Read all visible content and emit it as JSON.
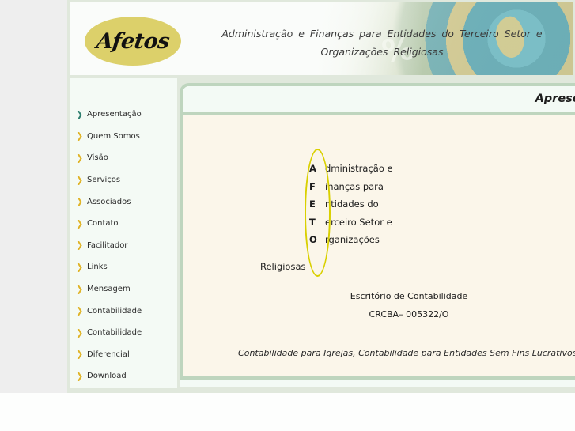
{
  "colors": {
    "page_border": "#bed5be",
    "logo_bg": "#dcd06a",
    "arrow_default": "#e0b429",
    "arrow_active": "#2f7f6f",
    "oval": "#d9d000",
    "content_bg": "#fbf6ea",
    "sidebar_bg": "#f4faf5",
    "gutter": "#eeeeee"
  },
  "header": {
    "logo_text": "Afetos",
    "tagline_line1": "Administração e Finanças para Entidades do Terceiro Setor e",
    "tagline_line2": "Organizações Religiosas",
    "photo_icon": "globe-icon",
    "percent_glyph": "%"
  },
  "sidebar": {
    "items": [
      {
        "label": "Apresentação",
        "active": true,
        "icon": "chevron-right-icon"
      },
      {
        "label": "Quem Somos",
        "active": false,
        "icon": "chevron-right-icon"
      },
      {
        "label": "Visão",
        "active": false,
        "icon": "chevron-right-icon"
      },
      {
        "label": "Serviços",
        "active": false,
        "icon": "chevron-right-icon"
      },
      {
        "label": "Associados",
        "active": false,
        "icon": "chevron-right-icon"
      },
      {
        "label": "Contato",
        "active": false,
        "icon": "chevron-right-icon"
      },
      {
        "label": "Facilitador",
        "active": false,
        "icon": "chevron-right-icon"
      },
      {
        "label": "Links",
        "active": false,
        "icon": "chevron-right-icon"
      },
      {
        "label": "Mensagem",
        "active": false,
        "icon": "chevron-right-icon"
      },
      {
        "label": "Contabilidade",
        "active": false,
        "icon": "chevron-right-icon"
      },
      {
        "label": "Contabilidade",
        "active": false,
        "icon": "chevron-right-icon"
      },
      {
        "label": "Diferencial",
        "active": false,
        "icon": "chevron-right-icon"
      },
      {
        "label": "Download",
        "active": false,
        "icon": "chevron-right-icon"
      }
    ],
    "arrow_glyph": "❯"
  },
  "content": {
    "title": "Apresentação",
    "acrostic": [
      {
        "cap": "A",
        "rest": "dministração e"
      },
      {
        "cap": "F",
        "rest": "inanças para"
      },
      {
        "cap": "E",
        "rest": "ntidades do"
      },
      {
        "cap": "T",
        "rest": "erceiro Setor e"
      },
      {
        "cap": "O",
        "rest": "rganizações"
      }
    ],
    "acrostic_last_line": "Religiosas",
    "office_line": "Escritório de Contabilidade",
    "crc_line": "CRCBA– 005322/O",
    "slogan_line": "Contabilidade para Igrejas, Contabilidade para Entidades Sem Fins Lucrativos."
  }
}
